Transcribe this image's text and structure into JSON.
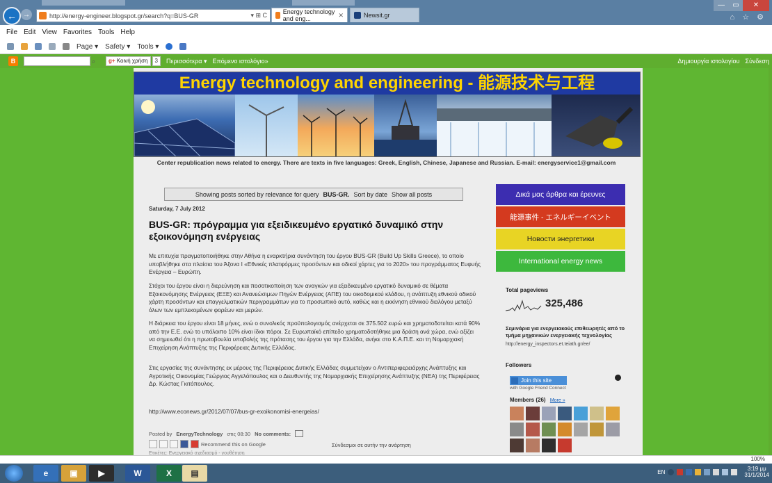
{
  "browser": {
    "url": "http://energy-engineer.blogspot.gr/search?q=BUS-GR",
    "address_controls": "▾ ⊞ C",
    "tabs": [
      {
        "label": "Energy technology and eng...",
        "active": true
      },
      {
        "label": "Newsit.gr",
        "active": false
      }
    ],
    "window_controls": {
      "minimize": "—",
      "maximize": "▭",
      "close": "✕"
    },
    "right_icons": "⌂ ☆ ⚙",
    "menu": [
      "File",
      "Edit",
      "View",
      "Favorites",
      "Tools",
      "Help"
    ],
    "command_bar": [
      "Page ▾",
      "Safety ▾",
      "Tools ▾"
    ],
    "zoom": "100%"
  },
  "navbar": {
    "share_label": "Κοινή χρήση",
    "share_count": "3",
    "more": "Περισσότερα ▾",
    "next_blog": "Επόμενο ιστολόγιο»",
    "create_blog": "Δημιουργία ιστολογίου",
    "sign_in": "Σύνδεση"
  },
  "blog": {
    "title": "Energy technology and engineering - 能源技术与工程",
    "description": "Center republication news related to energy. There are texts in five languages: Greek, English, Chinese, Japanese and Russian. E-mail: energyservice1@gmail.com"
  },
  "status": {
    "prefix": "Showing posts sorted by relevance for query",
    "query": "BUS-GR.",
    "sort": "Sort by date",
    "show_all": "Show all posts"
  },
  "post": {
    "date": "Saturday, 7 July 2012",
    "title": "BUS-GR: πρόγραμμα για εξειδικευμένο εργατικό δυναμικό στην εξοικονόμηση ενέργειας",
    "p1": "Με επιτυχία πραγματοποιήθηκε στην Αθήνα η εναρκτήρια συνάντηση του έργου BUS-GR (Build Up Skills Greece), το οποίο υποβλήθηκε στα πλαίσια του Άξονα I «Εθνικές πλατφόρμες προσόντων και οδικοί χάρτες για το 2020» του προγράμματος Ευφυής Ενέργεια – Ευρώπη.",
    "p2": "Στόχοι του έργου είναι η διερεύνηση και ποσοτικοποίηση των αναγκών για εξειδικευμένο εργατικό δυναμικό σε θέματα Εξοικονόμησης Ενέργειας (ΕΞΕ) και Ανανεώσιμων Πηγών Ενέργειας (ΑΠΕ) του οικοδομικού κλάδου, η ανάπτυξη εθνικού οδικού χάρτη προσόντων και επαγγελματικών περιγραμμάτων για το προσωπικό αυτό, καθώς και η εκκίνηση εθνικού διαλόγου μεταξύ όλων των εμπλεκομένων φορέων και μερών.",
    "p3": "Η διάρκεια του έργου είναι 18 μήνες, ενώ ο συνολικός προϋπολογισμός ανέρχεται σε 375.502 ευρώ και χρηματοδοτείται κατά 90% από την Ε.Ε. ενώ το υπόλοιπο 10% είναι ίδιοι πόροι. Σε Ευρωπαϊκό επίπεδο χρηματοδοτήθηκε μια δράση ανά χώρα, ενώ αξίζει να σημειωθεί ότι η πρωτοβουλία υποβολής της πρότασης του έργου για την Ελλάδα, ανήκε στο Κ.Α.Π.Ε. και τη Νομαρχιακή Επιχείρηση Ανάπτυξης της Περιφέρειας Δυτικής Ελλάδας.",
    "p4": "Στις εργασίες της συνάντησης εκ μέρους της Περιφέρειας Δυτικής Ελλάδας συμμετείχαν ο Αντιπεριφερειάρχης Ανάπτυξης και Αγροτικής Οικονομίας Γεώργιος Αγγελόπουλος και ο Διευθυντής της Νομαρχιακής Επιχείρησης Ανάπτυξης (ΝΕΑ) της Περιφέρειας Δρ. Κώστας Γκιτόπουλος.",
    "link": "http://www.econews.gr/2012/07/07/bus-gr-exoikonomisi-energeias/",
    "footer_posted_by": "Posted by",
    "author": "EnergyTechnology",
    "time": "στις 08:30",
    "comments": "No comments:",
    "recommend": "Recommend this on Google",
    "subscribe": "Σύνδεσμοι σε αυτήν την ανάρτηση",
    "labels": "Ετικέτες: Ενεργειακό σχεδιασμό - γουθέτηση"
  },
  "sidebar": {
    "buttons": [
      {
        "label": "Δικά μας άρθρα και έρευνες",
        "color": "#3c2db0"
      },
      {
        "label": "能源事件 - エネルギーイベント",
        "color": "#d43a1f"
      },
      {
        "label": "Новости энергетики",
        "color": "#e8d424"
      },
      {
        "label": "International energy news",
        "color": "#3db83d"
      }
    ],
    "pageviews_title": "Total pageviews",
    "pageviews_count": "325,486",
    "inspectors_title": "Σεμινάρια για ενεργειακούς επιθεωρητές από το τμήμα μηχανικών ενεργειακής τεχνολογίας",
    "inspectors_url": "http://energy_inspectors.et.teiath.gr/ee/",
    "followers_title": "Followers",
    "join_label": "Join this site",
    "gfc_text": "with Google Friend Connect",
    "members_title": "Members (26)",
    "members_more": "More »"
  },
  "taskbar": {
    "apps": [
      "e",
      "▣",
      "▶",
      "W",
      "X",
      "▤"
    ],
    "tray_lang": "EN",
    "time": "3:19 μμ",
    "date": "31/1/2014"
  }
}
